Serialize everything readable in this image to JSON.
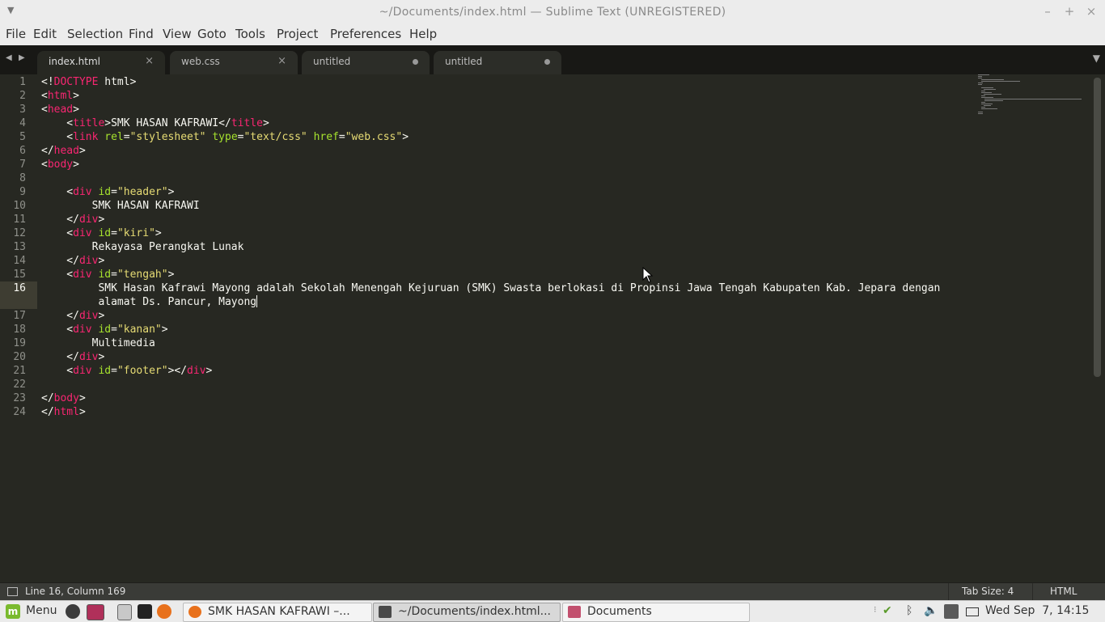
{
  "window": {
    "title": "~/Documents/index.html — Sublime Text (UNREGISTERED)",
    "minimize": "–",
    "maximize": "+",
    "close": "×"
  },
  "menu": {
    "items": [
      "File",
      "Edit",
      "Selection",
      "Find",
      "View",
      "Goto",
      "Tools",
      "Project",
      "Preferences",
      "Help"
    ]
  },
  "tabs": [
    {
      "label": "index.html",
      "state": "close",
      "active": true
    },
    {
      "label": "web.css",
      "state": "close",
      "active": false
    },
    {
      "label": "untitled",
      "state": "dirty",
      "active": false
    },
    {
      "label": "untitled",
      "state": "dirty",
      "active": false
    }
  ],
  "editor": {
    "current_line": 16,
    "lines": [
      {
        "n": "1",
        "tokens": [
          [
            "p",
            "<!"
          ],
          [
            "tg",
            "DOCTYPE"
          ],
          [
            "p",
            " html>"
          ]
        ]
      },
      {
        "n": "2",
        "tokens": [
          [
            "p",
            "<"
          ],
          [
            "tg",
            "html"
          ],
          [
            "p",
            ">"
          ]
        ]
      },
      {
        "n": "3",
        "tokens": [
          [
            "p",
            "<"
          ],
          [
            "tg",
            "head"
          ],
          [
            "p",
            ">"
          ]
        ]
      },
      {
        "n": "4",
        "tokens": [
          [
            "p",
            "    <"
          ],
          [
            "tg",
            "title"
          ],
          [
            "p",
            ">"
          ],
          [
            "tx",
            "SMK HASAN KAFRAWI"
          ],
          [
            "p",
            "</"
          ],
          [
            "tg",
            "title"
          ],
          [
            "p",
            ">"
          ]
        ]
      },
      {
        "n": "5",
        "tokens": [
          [
            "p",
            "    <"
          ],
          [
            "tg",
            "link"
          ],
          [
            "p",
            " "
          ],
          [
            "at",
            "rel"
          ],
          [
            "p",
            "="
          ],
          [
            "st",
            "\"stylesheet\""
          ],
          [
            "p",
            " "
          ],
          [
            "at",
            "type"
          ],
          [
            "p",
            "="
          ],
          [
            "st",
            "\"text/css\""
          ],
          [
            "p",
            " "
          ],
          [
            "at",
            "href"
          ],
          [
            "p",
            "="
          ],
          [
            "st",
            "\"web.css\""
          ],
          [
            "p",
            ">"
          ]
        ]
      },
      {
        "n": "6",
        "tokens": [
          [
            "p",
            "</"
          ],
          [
            "tg",
            "head"
          ],
          [
            "p",
            ">"
          ]
        ]
      },
      {
        "n": "7",
        "tokens": [
          [
            "p",
            "<"
          ],
          [
            "tg",
            "body"
          ],
          [
            "p",
            ">"
          ]
        ]
      },
      {
        "n": "8",
        "tokens": []
      },
      {
        "n": "9",
        "tokens": [
          [
            "p",
            "    <"
          ],
          [
            "tg",
            "div"
          ],
          [
            "p",
            " "
          ],
          [
            "at",
            "id"
          ],
          [
            "p",
            "="
          ],
          [
            "st",
            "\"header\""
          ],
          [
            "p",
            ">"
          ]
        ]
      },
      {
        "n": "10",
        "tokens": [
          [
            "tx",
            "        SMK HASAN KAFRAWI"
          ]
        ]
      },
      {
        "n": "11",
        "tokens": [
          [
            "p",
            "    </"
          ],
          [
            "tg",
            "div"
          ],
          [
            "p",
            ">"
          ]
        ]
      },
      {
        "n": "12",
        "tokens": [
          [
            "p",
            "    <"
          ],
          [
            "tg",
            "div"
          ],
          [
            "p",
            " "
          ],
          [
            "at",
            "id"
          ],
          [
            "p",
            "="
          ],
          [
            "st",
            "\"kiri\""
          ],
          [
            "p",
            ">"
          ]
        ]
      },
      {
        "n": "13",
        "tokens": [
          [
            "tx",
            "        Rekayasa Perangkat Lunak"
          ]
        ]
      },
      {
        "n": "14",
        "tokens": [
          [
            "p",
            "    </"
          ],
          [
            "tg",
            "div"
          ],
          [
            "p",
            ">"
          ]
        ]
      },
      {
        "n": "15",
        "tokens": [
          [
            "p",
            "    <"
          ],
          [
            "tg",
            "div"
          ],
          [
            "p",
            " "
          ],
          [
            "at",
            "id"
          ],
          [
            "p",
            "="
          ],
          [
            "st",
            "\"tengah\""
          ],
          [
            "p",
            ">"
          ]
        ]
      },
      {
        "n": "16",
        "tokens": [
          [
            "tx",
            "         SMK Hasan Kafrawi Mayong adalah Sekolah Menengah Kejuruan (SMK) Swasta berlokasi di Propinsi Jawa Tengah Kabupaten Kab. Jepara dengan"
          ]
        ]
      },
      {
        "n": "",
        "tokens": [
          [
            "tx",
            "         alamat Ds. Pancur, Mayong"
          ]
        ],
        "caret": true
      },
      {
        "n": "17",
        "tokens": [
          [
            "p",
            "    </"
          ],
          [
            "tg",
            "div"
          ],
          [
            "p",
            ">"
          ]
        ]
      },
      {
        "n": "18",
        "tokens": [
          [
            "p",
            "    <"
          ],
          [
            "tg",
            "div"
          ],
          [
            "p",
            " "
          ],
          [
            "at",
            "id"
          ],
          [
            "p",
            "="
          ],
          [
            "st",
            "\"kanan\""
          ],
          [
            "p",
            ">"
          ]
        ]
      },
      {
        "n": "19",
        "tokens": [
          [
            "tx",
            "        Multimedia"
          ]
        ]
      },
      {
        "n": "20",
        "tokens": [
          [
            "p",
            "    </"
          ],
          [
            "tg",
            "div"
          ],
          [
            "p",
            ">"
          ]
        ]
      },
      {
        "n": "21",
        "tokens": [
          [
            "p",
            "    <"
          ],
          [
            "tg",
            "div"
          ],
          [
            "p",
            " "
          ],
          [
            "at",
            "id"
          ],
          [
            "p",
            "="
          ],
          [
            "st",
            "\"footer\""
          ],
          [
            "p",
            "></"
          ],
          [
            "tg",
            "div"
          ],
          [
            "p",
            ">"
          ]
        ]
      },
      {
        "n": "22",
        "tokens": []
      },
      {
        "n": "23",
        "tokens": [
          [
            "p",
            "</"
          ],
          [
            "tg",
            "body"
          ],
          [
            "p",
            ">"
          ]
        ]
      },
      {
        "n": "24",
        "tokens": [
          [
            "p",
            "</"
          ],
          [
            "tg",
            "html"
          ],
          [
            "p",
            ">"
          ]
        ]
      }
    ]
  },
  "status": {
    "position": "Line 16, Column 169",
    "tab_size": "Tab Size: 4",
    "syntax": "HTML"
  },
  "taskbar": {
    "menu_label": "Menu",
    "windows": [
      {
        "label": "SMK HASAN KAFRAWI –...",
        "icon": "firefox-icon",
        "active": false
      },
      {
        "label": "~/Documents/index.html...",
        "icon": "sublime-icon",
        "active": true
      },
      {
        "label": "Documents",
        "icon": "folder-icon",
        "active": false
      }
    ],
    "clock": "Wed Sep  7, 14:15"
  },
  "colors": {
    "background": "#272822",
    "tag": "#f92672",
    "attribute": "#a6e22e",
    "string": "#e6db74",
    "text": "#f8f8f2"
  }
}
